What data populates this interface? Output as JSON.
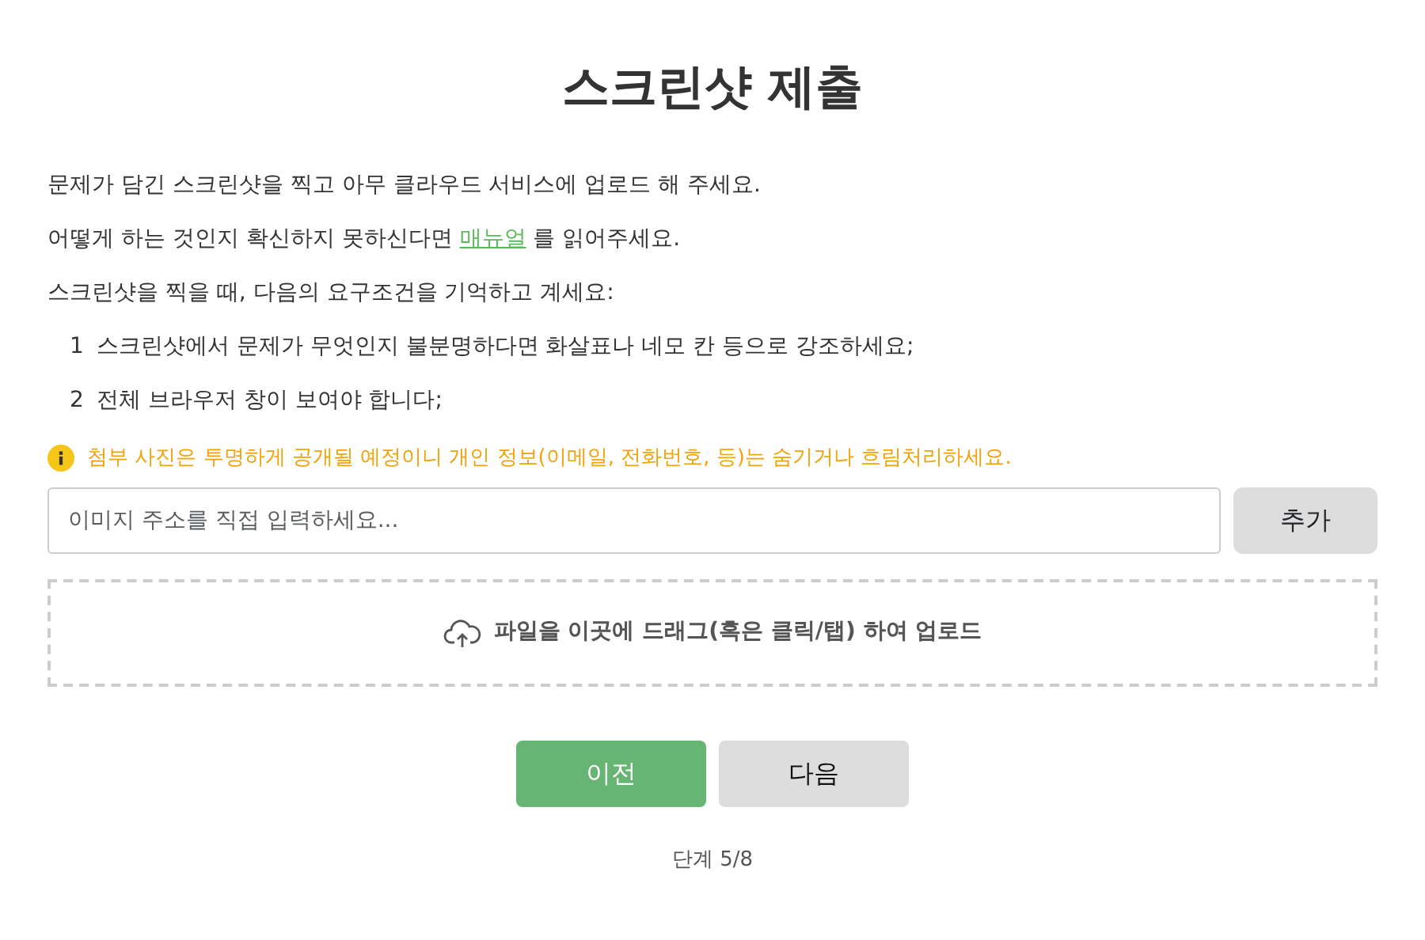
{
  "title": "스크린샷 제출",
  "intro": [
    {
      "kind": "text",
      "text": "문제가 담긴 스크린샷을 찍고 아무 클라우드 서비스에 업로드 해 주세요."
    },
    {
      "kind": "link",
      "before": "어떻게 하는 것인지 확신하지 못하신다면",
      "link": "매뉴얼",
      "after": "를 읽어주세요."
    },
    {
      "kind": "text",
      "text": "스크린샷을 찍을 때, 다음의 요구조건을 기억하고 계세요:"
    }
  ],
  "requirements": [
    {
      "number": "1",
      "text": "스크린샷에서 문제가 무엇인지 불분명하다면 화살표나 네모 칸 등으로 강조하세요;"
    },
    {
      "number": "2",
      "text": "전체 브라우저 창이 보여야 합니다;"
    }
  ],
  "warning": "첨부 사진은 투명하게 공개될 예정이니 개인 정보(이메일, 전화번호, 등)는 숨기거나 흐림처리하세요.",
  "url_field": {
    "placeholder": "이미지 주소를 직접 입력하세요..."
  },
  "add_button": "추가",
  "dropzone": "파일을 이곳에 드래그(혹은 클릭/탭) 하여 업로드",
  "nav_buttons": [
    {
      "label": "이전",
      "kind": "primary"
    },
    {
      "label": "다음",
      "kind": "secondary"
    }
  ],
  "step": "단계 5/8"
}
